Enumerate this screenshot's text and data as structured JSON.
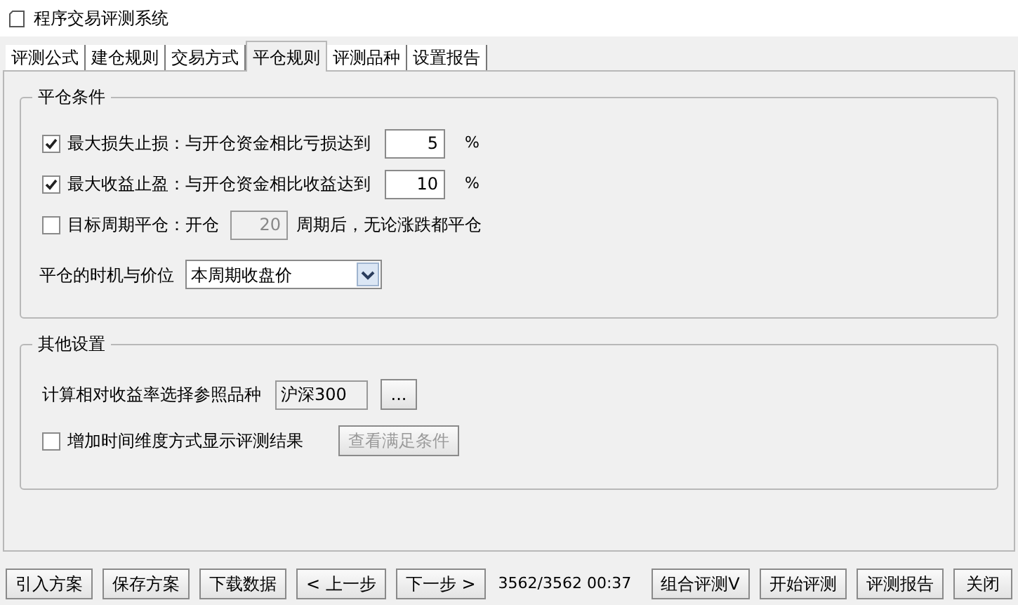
{
  "window": {
    "title": "程序交易评测系统"
  },
  "tabs": [
    {
      "label": "评测公式",
      "selected": false
    },
    {
      "label": "建仓规则",
      "selected": false
    },
    {
      "label": "交易方式",
      "selected": false
    },
    {
      "label": "平仓规则",
      "selected": true
    },
    {
      "label": "评测品种",
      "selected": false
    },
    {
      "label": "设置报告",
      "selected": false
    }
  ],
  "close_conditions": {
    "title": "平仓条件",
    "rows": [
      {
        "kind": "threshold",
        "checked": true,
        "label": "最大损失止损：与开仓资金相比亏损达到",
        "value": "5",
        "unit": "%"
      },
      {
        "kind": "threshold",
        "checked": true,
        "label": "最大收益止盈：与开仓资金相比收益达到",
        "value": "10",
        "unit": "%"
      },
      {
        "kind": "period",
        "checked": false,
        "label": "目标周期平仓：开仓",
        "value": "20",
        "disabled": true,
        "suffix": "周期后，无论涨跌都平仓"
      }
    ],
    "timing": {
      "label": "平仓的时机与价位",
      "value": "本周期收盘价"
    }
  },
  "other_settings": {
    "title": "其他设置",
    "benchmark": {
      "label": "计算相对收益率选择参照品种",
      "value": "沪深300",
      "button": "..."
    },
    "time_dimension": {
      "checked": false,
      "label": "增加时间维度方式显示评测结果",
      "button": "查看满足条件",
      "button_disabled": true
    }
  },
  "bottom_bar": {
    "left_buttons": [
      "引入方案",
      "保存方案",
      "下载数据",
      "< 上一步",
      "下一步 >"
    ],
    "status": "3562/3562 00:37",
    "right_buttons": [
      "组合评测V",
      "开始评测",
      "评测报告",
      "关闭"
    ]
  }
}
